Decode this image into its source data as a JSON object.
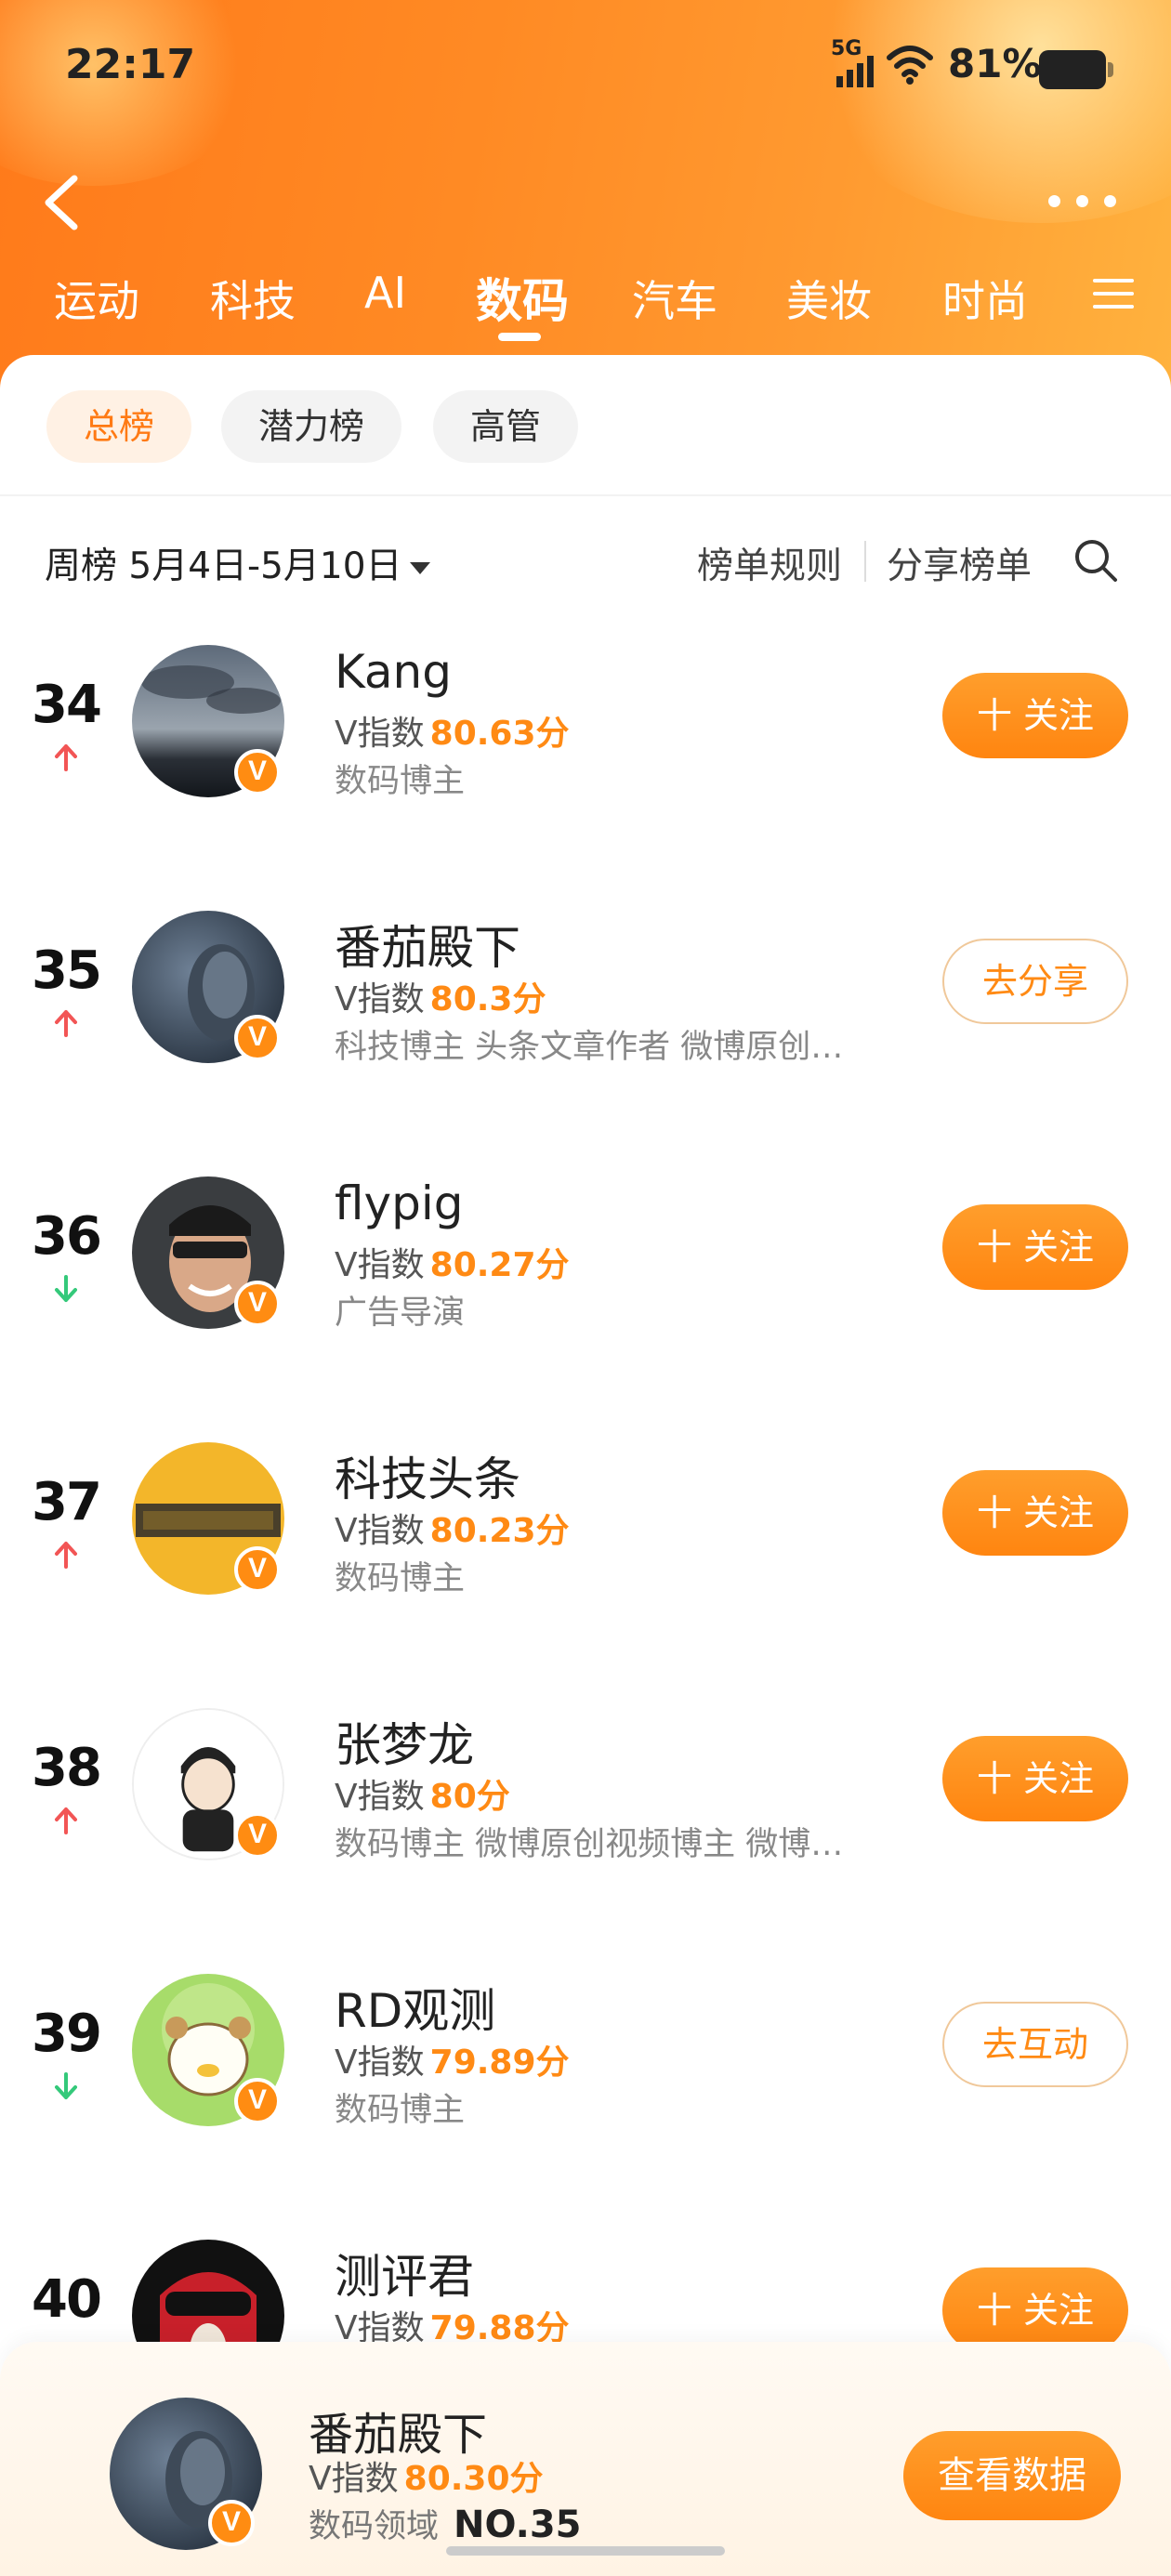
{
  "status_bar": {
    "time": "22:17",
    "network": "5G",
    "battery": "81%"
  },
  "tabs": [
    {
      "label": "运动"
    },
    {
      "label": "科技"
    },
    {
      "label": "AI"
    },
    {
      "label": "数码"
    },
    {
      "label": "汽车"
    },
    {
      "label": "美妆"
    },
    {
      "label": "时尚"
    }
  ],
  "active_tab": "数码",
  "chips": [
    {
      "label": "总榜"
    },
    {
      "label": "潜力榜"
    },
    {
      "label": "高管"
    }
  ],
  "filter": {
    "period": "周榜 5月4日-5月10日",
    "rules": "榜单规则",
    "share": "分享榜单"
  },
  "list": [
    {
      "rank": "34",
      "trend": "up",
      "name": "Kang",
      "score_label": "V指数",
      "score": "80.63分",
      "tags": "数码博主",
      "action": "十 关注"
    },
    {
      "rank": "35",
      "trend": "up",
      "name": "番茄殿下",
      "score_label": "V指数",
      "score": "80.3分",
      "tags": "科技博主 头条文章作者 微博原创…",
      "action": "去分享"
    },
    {
      "rank": "36",
      "trend": "down",
      "name": "flypig",
      "score_label": "V指数",
      "score": "80.27分",
      "tags": "广告导演",
      "action": "十 关注"
    },
    {
      "rank": "37",
      "trend": "up",
      "name": "科技头条",
      "score_label": "V指数",
      "score": "80.23分",
      "tags": "数码博主",
      "action": "十 关注"
    },
    {
      "rank": "38",
      "trend": "up",
      "name": "张梦龙",
      "score_label": "V指数",
      "score": "80分",
      "tags": "数码博主 微博原创视频博主 微博…",
      "action": "十 关注"
    },
    {
      "rank": "39",
      "trend": "down",
      "name": "RD观测",
      "score_label": "V指数",
      "score": "79.89分",
      "tags": "数码博主",
      "action": "去互动"
    },
    {
      "rank": "40",
      "trend": "up",
      "name": "测评君",
      "score_label": "V指数",
      "score": "79.88分",
      "tags": "",
      "action": "十 关注"
    }
  ],
  "me": {
    "name": "番茄殿下",
    "score_label": "V指数",
    "score": "80.30分",
    "domain": "数码领域",
    "rank": "NO.35",
    "button": "查看数据"
  },
  "colors": {
    "accent": "#ff8a14",
    "header": "#ff8a24"
  }
}
